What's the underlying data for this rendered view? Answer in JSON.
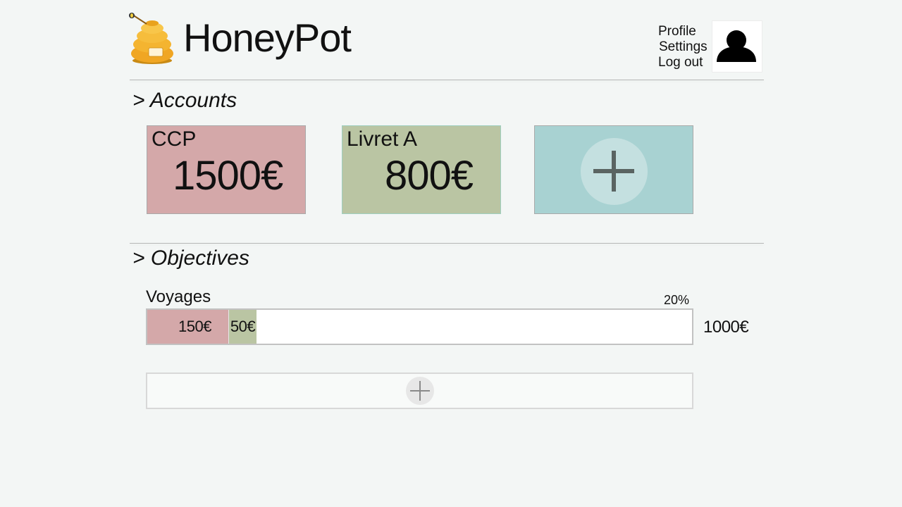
{
  "header": {
    "app_title": "HoneyPot",
    "logo": "honey-pot-logo",
    "menu": {
      "profile": "Profile",
      "settings": "Settings",
      "logout": "Log out"
    },
    "avatar_icon": "user-silhouette-icon"
  },
  "accounts": {
    "section_title": "> Accounts",
    "cards": [
      {
        "name": "CCP",
        "amount": "1500€",
        "color": "#d4a8a9"
      },
      {
        "name": "Livret A",
        "amount": "800€",
        "color": "#bac5a3"
      }
    ],
    "add_card": {
      "icon": "plus-icon",
      "color": "#a8d2d2"
    }
  },
  "objectives": {
    "section_title": "> Objectives",
    "items": [
      {
        "label": "Voyages",
        "percent_text": "20%",
        "total": "1000€",
        "segments": [
          {
            "amount": "150€",
            "value": 150,
            "color": "#d4a8a9"
          },
          {
            "amount": "50€",
            "value": 50,
            "color": "#bac5a3"
          }
        ],
        "goal_value": 1000
      }
    ],
    "add_objective": {
      "icon": "plus-icon"
    }
  }
}
